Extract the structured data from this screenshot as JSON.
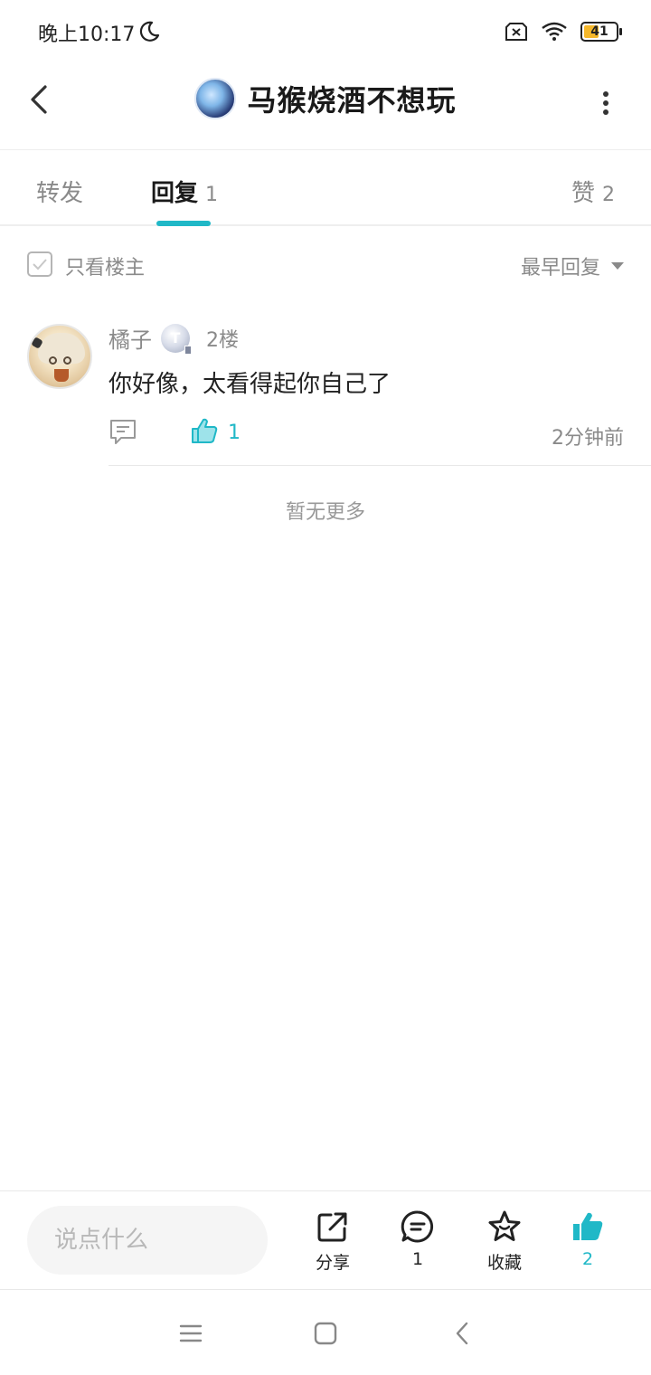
{
  "status_bar": {
    "time": "晚上10:17",
    "battery": "41",
    "icons": [
      "moon-icon",
      "sim-no-signal-icon",
      "wifi-icon",
      "battery-icon"
    ]
  },
  "header": {
    "title": "马猴烧酒不想玩",
    "icons": [
      "back-arrow-icon",
      "avatar",
      "more-vertical-icon"
    ]
  },
  "tabs": [
    {
      "label": "转发",
      "count": "",
      "active": false
    },
    {
      "label": "回复",
      "count": "1",
      "active": true
    },
    {
      "label": "赞",
      "count": "2",
      "active": false
    }
  ],
  "filter": {
    "only_op_label": "只看楼主",
    "only_op_checked": false,
    "sort_label": "最早回复"
  },
  "replies": [
    {
      "username": "橘子",
      "level_badge": "T",
      "floor": "2楼",
      "text": "你好像，太看得起你自己了",
      "like_count": "1",
      "time": "2分钟前"
    }
  ],
  "footer_note": "暂无更多",
  "bottom_bar": {
    "input_placeholder": "说点什么",
    "share_label": "分享",
    "comment_count": "1",
    "favorite_label": "收藏",
    "like_count": "2"
  },
  "colors": {
    "accent": "#20b8c7",
    "text_primary": "#222222",
    "text_secondary": "#8a8a8a",
    "divider": "#e8e8e8",
    "battery_fill": "#f5b72a"
  },
  "nav_bar": {
    "icons": [
      "menu-icon",
      "home-square-icon",
      "back-triangle-icon"
    ]
  }
}
